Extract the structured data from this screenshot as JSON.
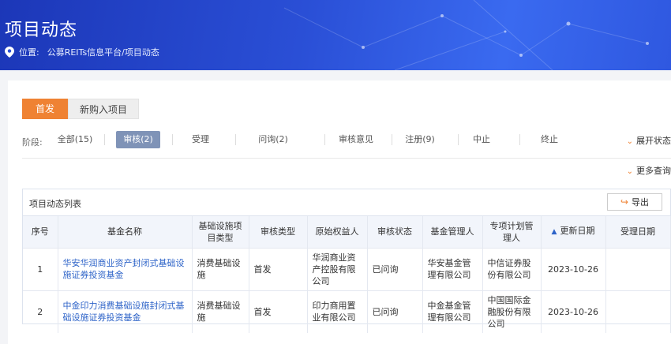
{
  "banner": {
    "title": "项目动态",
    "location_label": "位置:",
    "location_path": "公募REITs信息平台/项目动态"
  },
  "tabs": [
    {
      "label": "首发",
      "active": true
    },
    {
      "label": "新购入项目",
      "active": false
    }
  ],
  "filter": {
    "label": "阶段:",
    "items": [
      {
        "label": "全部(15)",
        "active": false
      },
      {
        "label": "审核(2)",
        "active": true
      },
      {
        "label": "受理",
        "active": false
      },
      {
        "label": "问询(2)",
        "active": false
      },
      {
        "label": "审核意见",
        "active": false
      },
      {
        "label": "注册(9)",
        "active": false
      },
      {
        "label": "中止",
        "active": false
      },
      {
        "label": "终止",
        "active": false
      }
    ],
    "expand_label": "展开状态"
  },
  "more_query": "更多查询",
  "panel": {
    "title": "项目动态列表",
    "export_label": "导出"
  },
  "table": {
    "headers": [
      "序号",
      "基金名称",
      "基础设施项目类型",
      "审核类型",
      "原始权益人",
      "审核状态",
      "基金管理人",
      "专项计划管理人",
      "更新日期",
      "受理日期"
    ],
    "rows": [
      {
        "no": "1",
        "fund": "华安华润商业资产封闭式基础设施证券投资基金",
        "type": "消费基础设施",
        "review": "首发",
        "owner": "华润商业资产控股有限公司",
        "status": "已问询",
        "manager": "华安基金管理有限公司",
        "plan_manager": "中信证券股份有限公司",
        "updated": "2023-10-26",
        "accepted": ""
      },
      {
        "no": "2",
        "fund": "中金印力消费基础设施封闭式基础设施证券投资基金",
        "type": "消费基础设施",
        "review": "首发",
        "owner": "印力商用置业有限公司",
        "status": "已问询",
        "manager": "中金基金管理有限公司",
        "plan_manager": "中国国际金融股份有限公司",
        "updated": "2023-10-26",
        "accepted": ""
      }
    ]
  },
  "colors": {
    "accent": "#ef8233",
    "active_filter": "#7f93b7",
    "link": "#2d63c8",
    "banner": "#2a4fd6"
  }
}
